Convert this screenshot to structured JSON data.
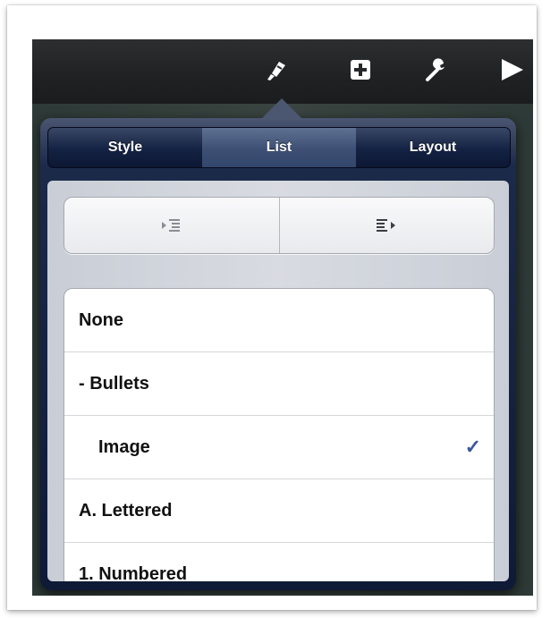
{
  "toolbar": {
    "icons": [
      "paintbrush-icon",
      "add-icon",
      "wrench-icon",
      "play-icon"
    ]
  },
  "tabs": [
    {
      "label": "Style"
    },
    {
      "label": "List"
    },
    {
      "label": "Layout"
    }
  ],
  "active_tab": "List",
  "indent": {
    "decrease_icon": "outdent-icon",
    "increase_icon": "indent-icon"
  },
  "list_styles": [
    {
      "label": "None"
    },
    {
      "label": "- Bullets"
    },
    {
      "label": "Image",
      "checked": true,
      "check_mark": "✓"
    },
    {
      "label": "A. Lettered"
    },
    {
      "label": "1. Numbered"
    }
  ],
  "colors": {
    "accent": "#3b5998"
  }
}
